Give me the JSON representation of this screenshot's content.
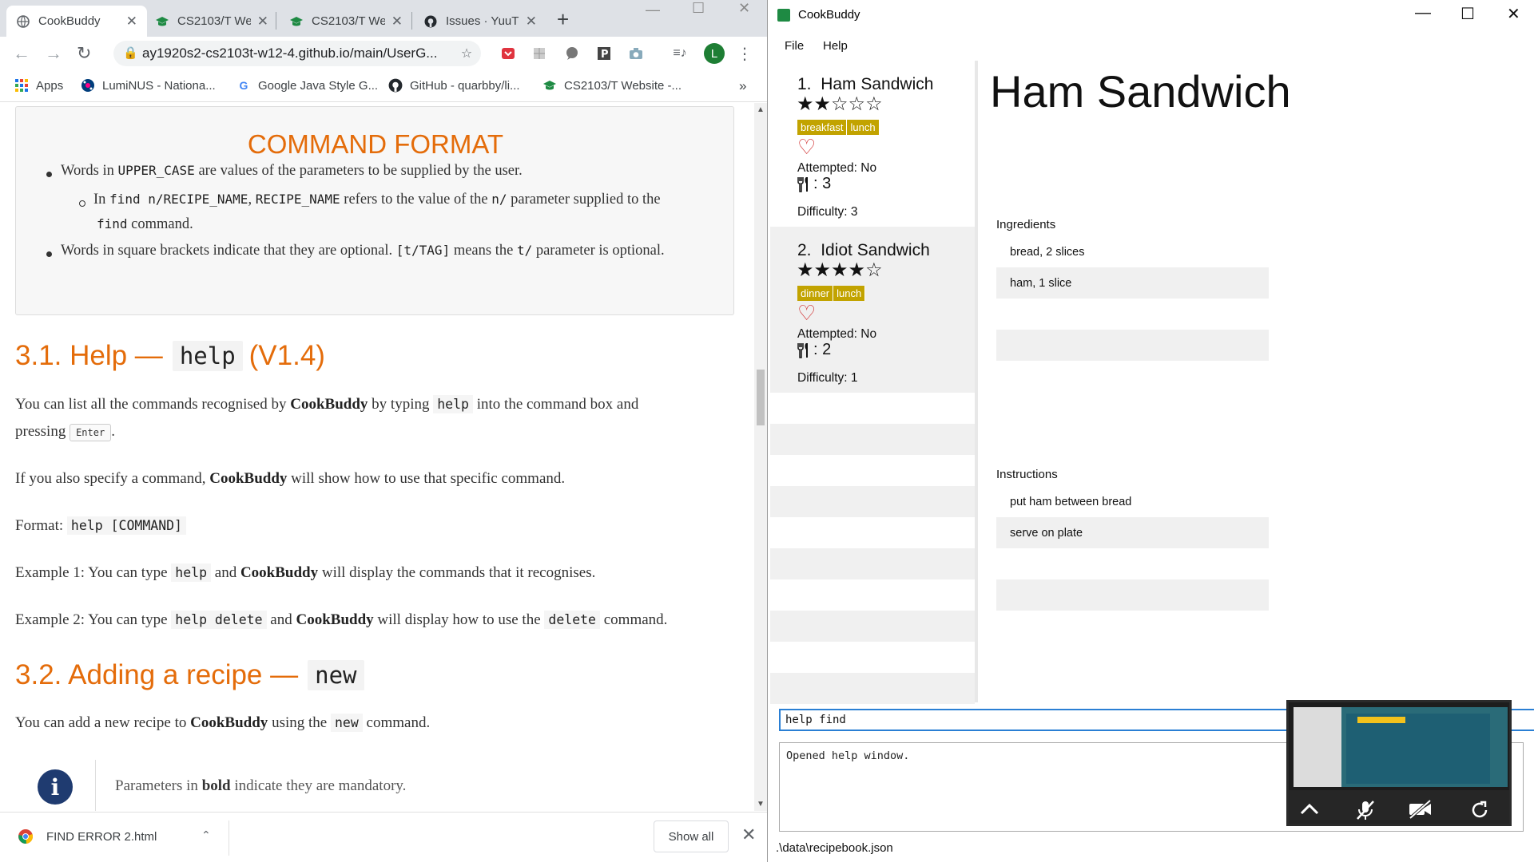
{
  "browser": {
    "tabs": [
      {
        "title": "CookBuddy",
        "icon": "globe-icon",
        "active": true
      },
      {
        "title": "CS2103/T We",
        "icon": "graduation-cap-icon",
        "active": false
      },
      {
        "title": "CS2103/T We",
        "icon": "graduation-cap-icon",
        "active": false
      },
      {
        "title": "Issues · YuuT",
        "icon": "github-icon",
        "active": false
      }
    ],
    "url": "ay1920s2-cs2103t-w12-4.github.io/main/UserG...",
    "profile_initial": "L",
    "bookmarks": [
      {
        "label": "Apps",
        "icon": "apps-grid-icon"
      },
      {
        "label": "LumiNUS - Nationa...",
        "icon": "luminus-icon"
      },
      {
        "label": "Google Java Style G...",
        "icon": "google-icon"
      },
      {
        "label": "GitHub - quarbby/li...",
        "icon": "github-icon"
      },
      {
        "label": "CS2103/T Website -...",
        "icon": "graduation-cap-icon"
      }
    ],
    "bookmarks_overflow": "»",
    "colors": {
      "heading": "#e46c0a",
      "tabstrip": "#dee1e6"
    }
  },
  "doc": {
    "format_box": {
      "title": "COMMAND FORMAT",
      "line1_pre": "Words in ",
      "line1_code": "UPPER_CASE",
      "line1_post": " are values of the parameters to be supplied by the user.",
      "line2_pre": "In ",
      "line2_code1": "find n/RECIPE_NAME",
      "line2_mid1": ", ",
      "line2_code2": "RECIPE_NAME",
      "line2_mid2": " refers to the value of the ",
      "line2_code3": "n/",
      "line2_post": " parameter supplied to the",
      "line3_code": "find",
      "line3_post": " command.",
      "line4_pre": "Words in square brackets indicate that they are optional. ",
      "line4_code1": "[t/TAG]",
      "line4_mid": " means the ",
      "line4_code2": "t/",
      "line4_post": " parameter is optional."
    },
    "help_section": {
      "heading_pre": "3.1. Help —",
      "heading_code": "help",
      "heading_post": "(V1.4)",
      "p1_a": "You can list all the commands recognised by ",
      "p1_b": "CookBuddy",
      "p1_c": " by typing ",
      "p1_code": "help",
      "p1_d": " into the command box and",
      "p1_e": "pressing ",
      "p1_kbd": "Enter",
      "p1_f": ".",
      "p2_a": "If you also specify a command, ",
      "p2_b": "CookBuddy",
      "p2_c": " will show how to use that specific command.",
      "format_label": "Format: ",
      "format_code": "help [COMMAND]",
      "ex1_a": "Example 1: You can type ",
      "ex1_code": "help",
      "ex1_b": " and ",
      "ex1_c": "CookBuddy",
      "ex1_d": " will display the commands that it recognises.",
      "ex2_a": "Example 2: You can type ",
      "ex2_code": "help delete",
      "ex2_b": " and ",
      "ex2_c": "CookBuddy",
      "ex2_d": " will display how to use the ",
      "ex2_code2": "delete",
      "ex2_e": " command."
    },
    "new_section": {
      "heading_pre": "3.2. Adding a recipe —",
      "heading_code": "new",
      "p1_a": "You can add a new recipe to ",
      "p1_b": "CookBuddy",
      "p1_c": " using the ",
      "p1_code": "new",
      "p1_d": " command.",
      "info_a": "Parameters in ",
      "info_b": "bold",
      "info_c": " indicate they are mandatory."
    }
  },
  "downloads": {
    "filename": "FIND ERROR 2.html",
    "show_all": "Show all"
  },
  "cookbuddy": {
    "window_title": "CookBuddy",
    "menus": [
      "File",
      "Help"
    ],
    "recipes": [
      {
        "index": "1.",
        "name": "Ham Sandwich",
        "rating": 2,
        "rating_max": 5,
        "tags": [
          "breakfast",
          "lunch"
        ],
        "attempted": "Attempted: No",
        "servings": ": 3",
        "difficulty": "Difficulty: 3"
      },
      {
        "index": "2.",
        "name": "Idiot Sandwich",
        "rating": 4,
        "rating_max": 5,
        "tags": [
          "dinner",
          "lunch"
        ],
        "attempted": "Attempted: No",
        "servings": ": 2",
        "difficulty": "Difficulty: 1"
      }
    ],
    "detail": {
      "title": "Ham Sandwich",
      "ingredients_label": "Ingredients",
      "ingredients": [
        "bread, 2 slices",
        "ham, 1 slice",
        "",
        "",
        ""
      ],
      "instructions_label": "Instructions",
      "instructions": [
        "put ham between bread",
        "serve on plate",
        "",
        "",
        ""
      ]
    },
    "command_input": "help find",
    "result": "Opened help window.",
    "status_path": ".\\data\\recipebook.json",
    "colors": {
      "tag": "#c2a300",
      "heart": "#d03030",
      "command_border": "#2a7fd4"
    }
  }
}
